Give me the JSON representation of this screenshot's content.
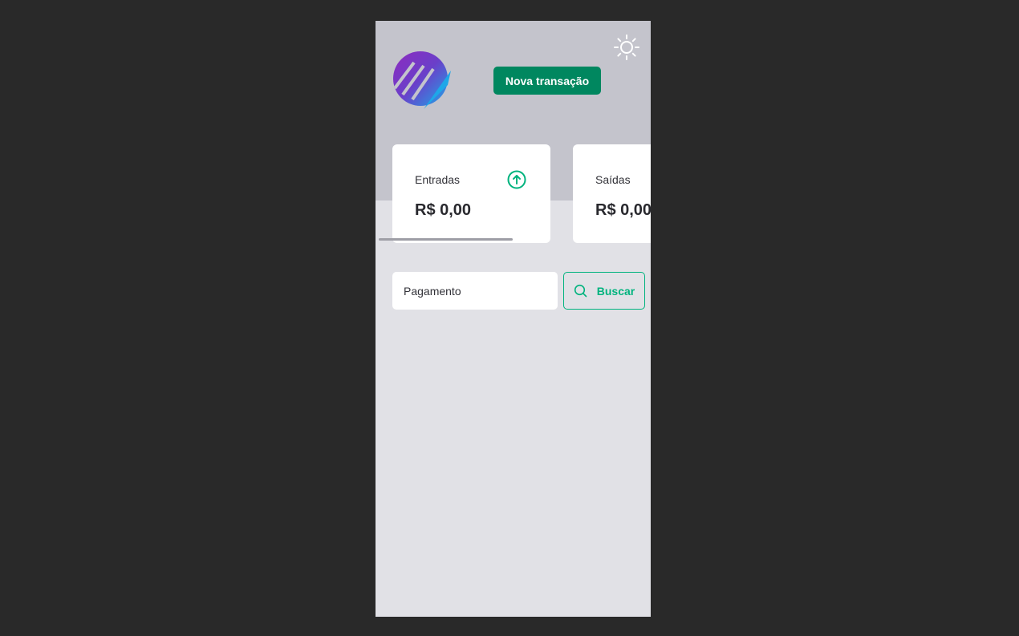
{
  "header": {
    "new_transaction_label": "Nova transação",
    "theme_icon": "sun-icon",
    "logo": "app-logo"
  },
  "summary": {
    "income": {
      "title": "Entradas",
      "value": "R$ 0,00",
      "icon": "arrow-circle-up-icon",
      "icon_color": "#00b37e"
    },
    "outcome": {
      "title": "Saídas",
      "value": "R$ 0,00"
    }
  },
  "search": {
    "value": "Pagamento",
    "button_label": "Buscar",
    "button_icon": "search-icon"
  },
  "colors": {
    "background": "#292929",
    "header": "#c4c4cc",
    "surface": "#e1e1e6",
    "brand": "#00875f",
    "accent": "#00b37e"
  }
}
